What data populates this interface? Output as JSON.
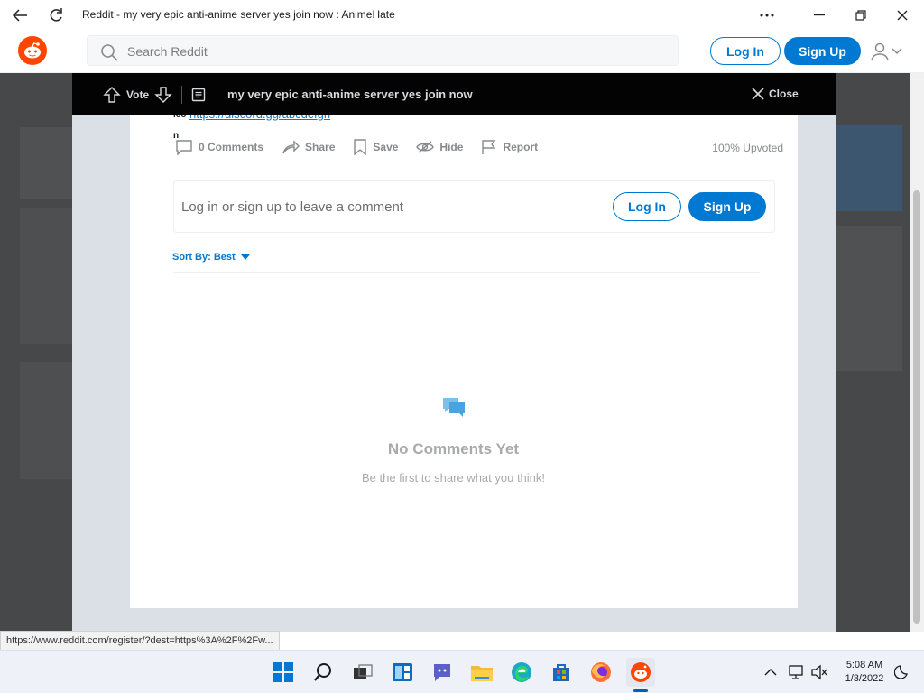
{
  "browser": {
    "tab_title": "Reddit - my very epic anti-anime server yes join now : AnimeHate"
  },
  "header": {
    "search_placeholder": "Search Reddit",
    "login_label": "Log In",
    "signup_label": "Sign Up"
  },
  "modal": {
    "vote_label": "Vote",
    "post_title": "my very epic anti-anime server yes join now",
    "close_label": "Close",
    "clipped_fragment_1": "lco",
    "clipped_fragment_2": "n",
    "actions": {
      "comments": "0 Comments",
      "share": "Share",
      "save": "Save",
      "hide": "Hide",
      "report": "Report"
    },
    "upvoted": "100% Upvoted",
    "comment_prompt": "Log in or sign up to leave a comment",
    "login_label": "Log In",
    "signup_label": "Sign Up",
    "sort_label": "Sort By: Best",
    "empty_title": "No Comments Yet",
    "empty_subtitle": "Be the first to share what you think!"
  },
  "status_bar": {
    "url": "https://www.reddit.com/register/?dest=https%3A%2F%2Fw..."
  },
  "taskbar": {
    "time": "5:08 AM",
    "date": "1/3/2022"
  },
  "colors": {
    "reddit_orange": "#ff4500",
    "reddit_blue": "#0079d3",
    "modal_bar": "#030303",
    "taskbar": "#eef1f7"
  },
  "icons": [
    "back-arrow-icon",
    "refresh-icon",
    "more-icon",
    "minimize-icon",
    "maximize-icon",
    "window-close-icon",
    "reddit-logo-icon",
    "search-icon",
    "user-icon",
    "chevron-down-icon",
    "upvote-icon",
    "downvote-icon",
    "post-icon",
    "close-icon",
    "comment-icon",
    "share-icon",
    "save-icon",
    "hide-icon",
    "report-icon",
    "caret-down-icon",
    "chat-bubbles-icon",
    "windows-start-icon",
    "search-taskbar-icon",
    "task-view-icon",
    "widgets-icon",
    "teams-chat-icon",
    "file-explorer-icon",
    "edge-icon",
    "store-icon",
    "firefox-icon",
    "reddit-taskbar-icon",
    "chevron-up-icon",
    "network-icon",
    "volume-muted-icon",
    "notification-icon"
  ]
}
